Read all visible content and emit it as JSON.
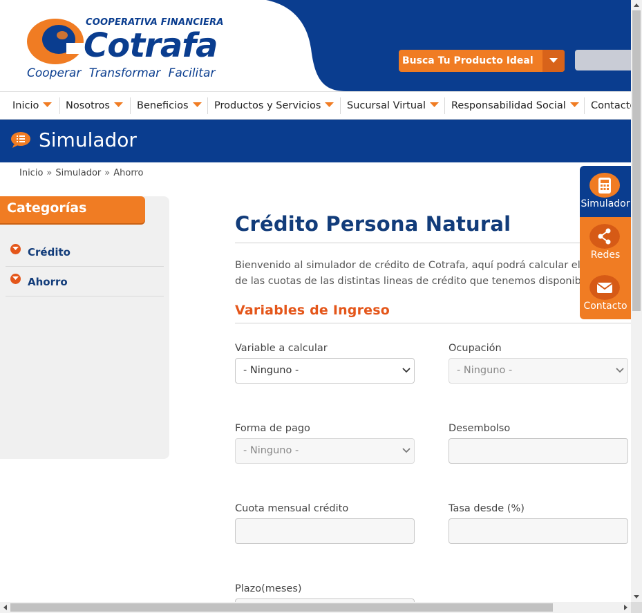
{
  "header": {
    "logo_top": "COOPERATIVA FINANCIERA",
    "logo_main": "Cotrafa",
    "logo_tagline": "Cooperar  Transformar  Facilitar",
    "product_button": "Busca Tu Producto Ideal",
    "colors": {
      "brand_blue": "#0a3d8f",
      "brand_orange": "#f07c23"
    }
  },
  "nav": {
    "items": [
      {
        "label": "Inicio"
      },
      {
        "label": "Nosotros"
      },
      {
        "label": "Beneficios"
      },
      {
        "label": "Productos y Servicios"
      },
      {
        "label": "Sucursal Virtual"
      },
      {
        "label": "Responsabilidad Social"
      },
      {
        "label": "Contacto"
      }
    ]
  },
  "banner": {
    "title": "Simulador",
    "icon": "list-icon"
  },
  "breadcrumb": {
    "items": [
      "Inicio",
      "Simulador",
      "Ahorro"
    ],
    "separator": "»"
  },
  "sidebar": {
    "heading": "Categorías",
    "items": [
      {
        "label": "Crédito",
        "icon": "chevron-down-icon"
      },
      {
        "label": "Ahorro",
        "icon": "chevron-down-icon"
      }
    ]
  },
  "main": {
    "title": "Crédito Persona Natural",
    "intro_line1": "Bienvenido al simulador de crédito de Cotrafa, aquí podrá calcular el valor",
    "intro_line2": "de las cuotas de las distintas lineas de crédito que tenemos disponibles.",
    "section_title": "Variables de Ingreso",
    "fields": {
      "variable": {
        "label": "Variable a calcular",
        "value": "- Ninguno -"
      },
      "ocupacion": {
        "label": "Ocupación",
        "value": "- Ninguno -"
      },
      "forma_pago": {
        "label": "Forma de pago",
        "value": "- Ninguno -"
      },
      "desembolso": {
        "label": "Desembolso",
        "value": ""
      },
      "cuota": {
        "label": "Cuota mensual crédito",
        "value": ""
      },
      "tasa": {
        "label": "Tasa desde (%)",
        "value": ""
      },
      "plazo": {
        "label": "Plazo(meses)",
        "value": ""
      }
    }
  },
  "floating_menu": {
    "items": [
      {
        "label": "Simulador",
        "icon": "calculator-icon"
      },
      {
        "label": "Redes",
        "icon": "share-icon"
      },
      {
        "label": "Contacto",
        "icon": "mail-icon"
      }
    ]
  }
}
